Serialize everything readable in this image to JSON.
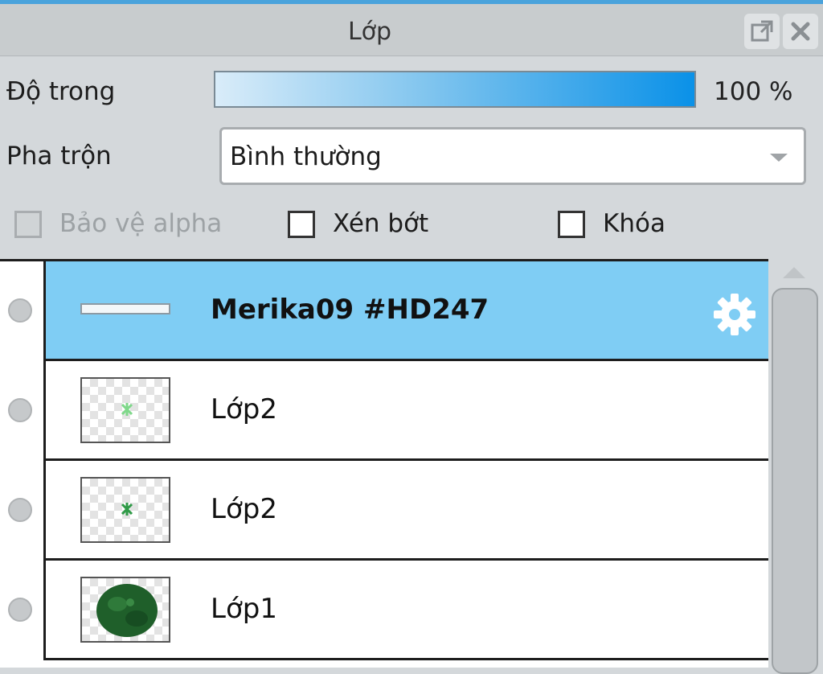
{
  "panel": {
    "title": "Lớp"
  },
  "opacity": {
    "label": "Độ trong",
    "value_text": "100 %",
    "fraction": 1.0
  },
  "blend": {
    "label": "Pha trộn",
    "value": "Bình thường"
  },
  "checkboxes": [
    {
      "label": "Bảo vệ alpha",
      "checked": false,
      "disabled": true
    },
    {
      "label": "Xén bớt",
      "checked": false,
      "disabled": false
    },
    {
      "label": "Khóa",
      "checked": false,
      "disabled": false
    }
  ],
  "layers": [
    {
      "name": "Merika09 #HD247",
      "selected": true,
      "type": "group",
      "icon": "gear-icon"
    },
    {
      "name": "Lớp2",
      "selected": false,
      "type": "layer",
      "thumbnail": "small-green-mark"
    },
    {
      "name": "Lớp2",
      "selected": false,
      "type": "layer",
      "thumbnail": "small-green-mark"
    },
    {
      "name": "Lớp1",
      "selected": false,
      "type": "layer",
      "thumbnail": "dark-green-blob"
    }
  ],
  "colors": {
    "accent": "#4aa3dc",
    "selected_row": "#7fcdf4",
    "opacity_fill": "#0a91e8"
  }
}
